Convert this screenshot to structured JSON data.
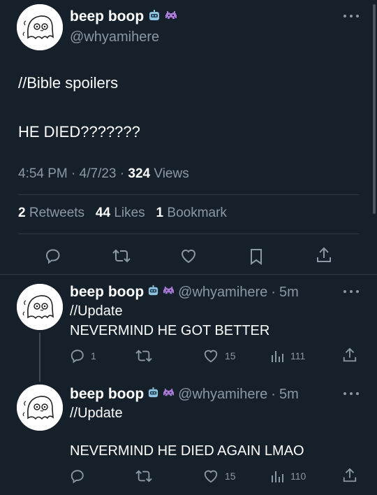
{
  "main_tweet": {
    "display_name": "beep boop",
    "handle": "@whyamihere",
    "line1": "//Bible spoilers",
    "line2": "HE DIED???????",
    "time": "4:54 PM",
    "date": "4/7/23",
    "views_count": "324",
    "views_label": "Views",
    "retweets_count": "2",
    "retweets_label": "Retweets",
    "likes_count": "44",
    "likes_label": "Likes",
    "bookmarks_count": "1",
    "bookmarks_label": "Bookmark",
    "separator": "·"
  },
  "reply1": {
    "display_name": "beep boop",
    "handle": "@whyamihere",
    "age": "5m",
    "line1": "//Update",
    "line2": "NEVERMIND HE GOT BETTER",
    "reply_count": "1",
    "like_count": "15",
    "view_count": "111"
  },
  "reply2": {
    "display_name": "beep boop",
    "handle": "@whyamihere",
    "age": "5m",
    "line1": "//Update",
    "line2": "NEVERMIND HE DIED AGAIN LMAO",
    "like_count": "15",
    "view_count": "110"
  },
  "colors": {
    "background": "#15202b",
    "muted_text": "#8b98a5",
    "divider": "#2f3b47",
    "thread_line": "#3d4a57"
  },
  "icons": [
    "robot-emoji",
    "alien-monster-emoji",
    "more-icon",
    "reply-icon",
    "retweet-icon",
    "like-icon",
    "bookmark-icon",
    "share-icon",
    "views-icon"
  ]
}
